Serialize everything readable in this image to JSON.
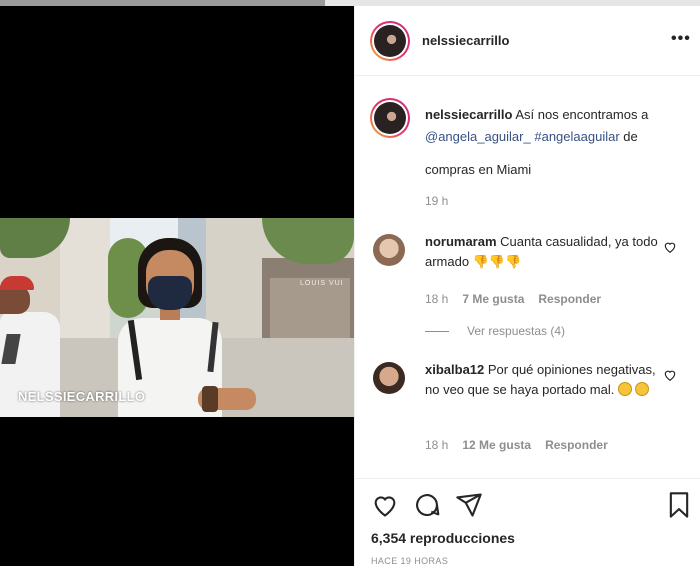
{
  "post": {
    "username": "nelssiecarrillo",
    "more_label": "•••",
    "watermark": "NELSSIECARRILLO",
    "store_sign": "LOUIS VUI"
  },
  "caption": {
    "username": "nelssiecarrillo",
    "text_start": " Así nos encontramos a",
    "mention": "@angela_aguilar_",
    "hashtag": "#angelaaguilar",
    "text_end": " de",
    "line2": "compras en Miami",
    "time": "19 h"
  },
  "comments": [
    {
      "username": "norumaram",
      "text": " Cuanta casualidad, ya todo armado",
      "time": "18 h",
      "likes": "7 Me gusta",
      "reply": "Responder"
    },
    {
      "username": "xibalba12",
      "text": " Por qué opiniones negativas, no veo que se haya portado mal.",
      "time": "18 h",
      "likes": "12 Me gusta",
      "reply": "Responder"
    }
  ],
  "view_replies": "Ver respuestas (4)",
  "footer": {
    "views_count": "6,354",
    "views_label": " reproducciones",
    "ago": "HACE 19 HORAS"
  },
  "icons": {
    "heart": "heart-icon",
    "comment": "comment-icon",
    "share": "share-icon",
    "save": "bookmark-icon",
    "more": "more-icon"
  }
}
